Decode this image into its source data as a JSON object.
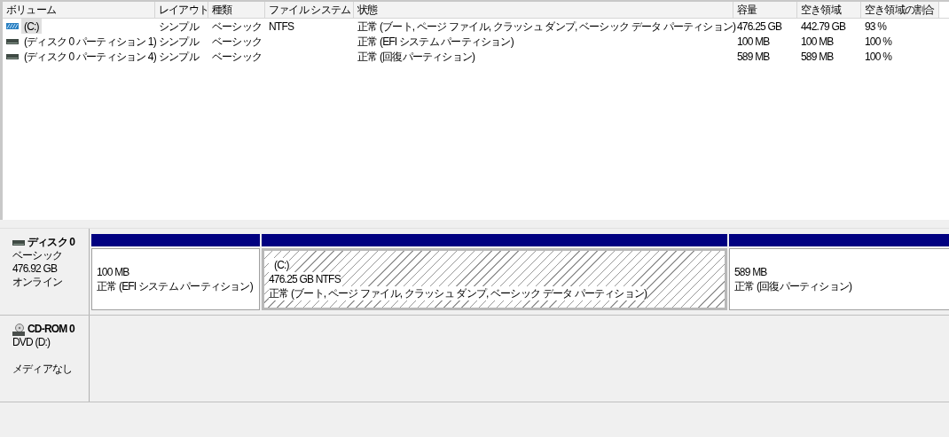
{
  "volume_list": {
    "columns": [
      "ボリューム",
      "レイアウト",
      "種類",
      "ファイル システム",
      "状態",
      "容量",
      "空き領域",
      "空き領域の割合"
    ],
    "rows": [
      {
        "kind": "system",
        "selected": true,
        "cells": [
          "(C:)",
          "シンプル",
          "ベーシック",
          "NTFS",
          "正常 (ブート, ページ ファイル, クラッシュ ダンプ, ベーシック データ パーティション)",
          "476.25 GB",
          "442.79 GB",
          "93 %"
        ]
      },
      {
        "kind": "partition",
        "selected": false,
        "cells": [
          "(ディスク 0 パーティション 1)",
          "シンプル",
          "ベーシック",
          "",
          "正常 (EFI システム パーティション)",
          "100 MB",
          "100 MB",
          "100 %"
        ]
      },
      {
        "kind": "partition",
        "selected": false,
        "cells": [
          "(ディスク 0 パーティション 4)",
          "シンプル",
          "ベーシック",
          "",
          "正常 (回復パーティション)",
          "589 MB",
          "589 MB",
          "100 %"
        ]
      }
    ]
  },
  "disks": [
    {
      "kind": "disk",
      "name": "ディスク 0",
      "lines": [
        "ベーシック",
        "476.92 GB",
        "オンライン"
      ],
      "partitions": [
        {
          "selected": false,
          "size": "100 MB",
          "status": "正常 (EFI システム パーティション)"
        },
        {
          "selected": true,
          "label": "(C:)",
          "size": "476.25 GB NTFS",
          "status": "正常 (ブート, ページ ファイル, クラッシュ ダンプ, ベーシック データ パーティション)"
        },
        {
          "selected": false,
          "size": "589 MB",
          "status": "正常 (回復パーティション)"
        }
      ]
    },
    {
      "kind": "cdrom",
      "name": "CD-ROM 0",
      "lines": [
        "DVD (D:)",
        "メディアなし"
      ]
    }
  ]
}
